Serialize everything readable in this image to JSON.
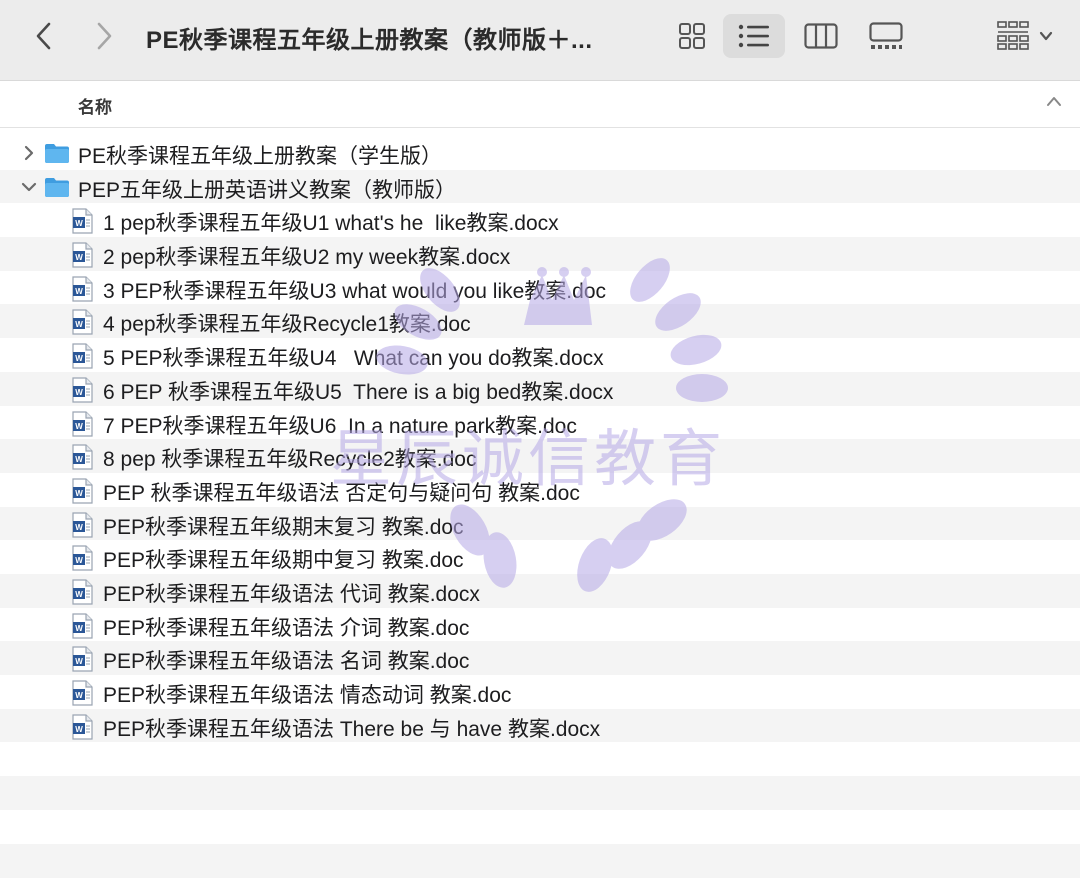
{
  "toolbar": {
    "title": "PE秋季课程五年级上册教案（教师版＋...",
    "back_icon": "chevron-left-icon",
    "forward_icon": "chevron-right-icon",
    "views": [
      "icon-view",
      "list-view",
      "column-view",
      "gallery-view"
    ],
    "active_view": "list-view",
    "group_icon": "group-by-icon"
  },
  "header": {
    "name_label": "名称",
    "sort": "ascending"
  },
  "list": {
    "folders": [
      {
        "label": "PE秋季课程五年级上册教案（学生版）",
        "expanded": false
      },
      {
        "label": "PEP五年级上册英语讲义教案（教师版）",
        "expanded": true
      }
    ],
    "files": [
      "1 pep秋季课程五年级U1 what's he  like教案.docx",
      "2 pep秋季课程五年级U2 my week教案.docx",
      "3 PEP秋季课程五年级U3 what would you like教案.doc",
      "4 pep秋季课程五年级Recycle1教案.doc",
      "5 PEP秋季课程五年级U4   What can you do教案.docx",
      "6 PEP 秋季课程五年级U5  There is a big bed教案.docx",
      "7 PEP秋季课程五年级U6  In a nature park教案.doc",
      "8 pep 秋季课程五年级Recycle2教案.doc",
      "PEP 秋季课程五年级语法 否定句与疑问句 教案.doc",
      "PEP秋季课程五年级期末复习 教案.doc",
      "PEP秋季课程五年级期中复习 教案.doc",
      "PEP秋季课程五年级语法 代词 教案.docx",
      "PEP秋季课程五年级语法 介词 教案.doc",
      "PEP秋季课程五年级语法 名词 教案.doc",
      "PEP秋季课程五年级语法 情态动词 教案.doc",
      "PEP秋季课程五年级语法 There be 与 have 教案.docx"
    ]
  },
  "watermark": {
    "text": "星辰诚信教育",
    "color": "#b6a8e6"
  },
  "colors": {
    "toolbar_bg": "#ececec",
    "folder_blue": "#5aaee8",
    "row_alt": "#f4f4f4",
    "word_blue": "#2b5797"
  }
}
